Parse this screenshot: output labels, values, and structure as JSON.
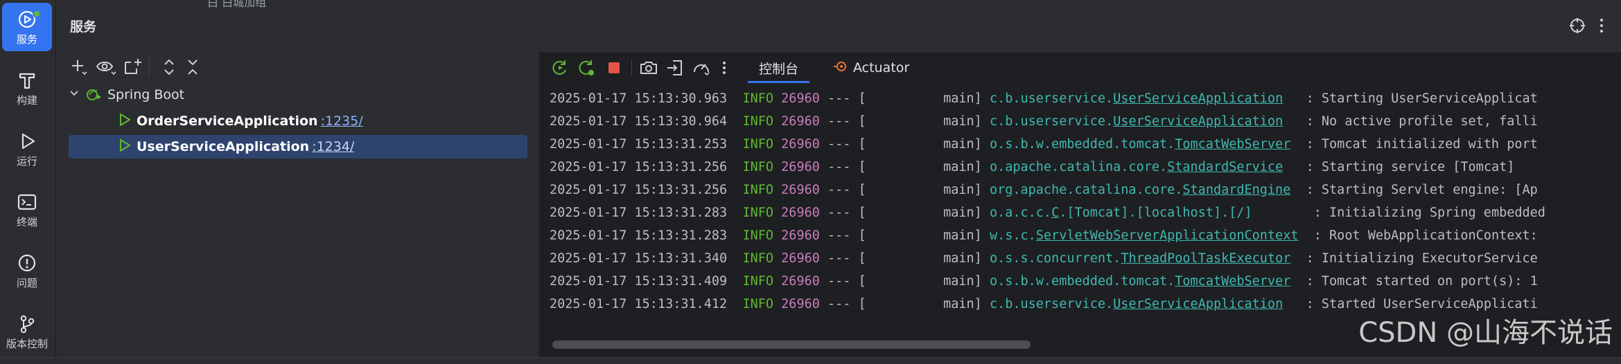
{
  "activity_bar": {
    "items": [
      {
        "label": "服务",
        "icon": "services-icon",
        "active": true
      },
      {
        "label": "构建",
        "icon": "build-hammer-icon",
        "active": false
      },
      {
        "label": "运行",
        "icon": "run-icon",
        "active": false
      },
      {
        "label": "终端",
        "icon": "terminal-icon",
        "active": false
      },
      {
        "label": "问题",
        "icon": "problems-icon",
        "active": false
      },
      {
        "label": "版本控制",
        "icon": "vcs-branch-icon",
        "active": false
      }
    ]
  },
  "header": {
    "title": "服务",
    "top_fragment": "白 白城加组"
  },
  "tree": {
    "root_label": "Spring Boot",
    "apps": [
      {
        "name": "OrderServiceApplication",
        "port": ":1235/",
        "selected": false
      },
      {
        "name": "UserServiceApplication",
        "port": ":1234/",
        "selected": true
      }
    ]
  },
  "console": {
    "tabs": [
      {
        "label": "控制台",
        "active": true
      },
      {
        "label": "Actuator",
        "active": false
      }
    ],
    "log": [
      {
        "ts": "2025-01-17 15:13:30.963",
        "level": "INFO",
        "pid": "26960",
        "sep": "--- [",
        "thread": "main]",
        "logger_pkg": "c.b.userservice.",
        "logger_cls": "UserServiceApplication",
        "msg": ": Starting UserServiceApplicat"
      },
      {
        "ts": "2025-01-17 15:13:30.964",
        "level": "INFO",
        "pid": "26960",
        "sep": "--- [",
        "thread": "main]",
        "logger_pkg": "c.b.userservice.",
        "logger_cls": "UserServiceApplication",
        "msg": ": No active profile set, falli"
      },
      {
        "ts": "2025-01-17 15:13:31.253",
        "level": "INFO",
        "pid": "26960",
        "sep": "--- [",
        "thread": "main]",
        "logger_pkg": "o.s.b.w.embedded.tomcat.",
        "logger_cls": "TomcatWebServer",
        "msg": ": Tomcat initialized with port"
      },
      {
        "ts": "2025-01-17 15:13:31.256",
        "level": "INFO",
        "pid": "26960",
        "sep": "--- [",
        "thread": "main]",
        "logger_pkg": "o.apache.catalina.core.",
        "logger_cls": "StandardService",
        "msg": ": Starting service [Tomcat]"
      },
      {
        "ts": "2025-01-17 15:13:31.256",
        "level": "INFO",
        "pid": "26960",
        "sep": "--- [",
        "thread": "main]",
        "logger_pkg": "org.apache.catalina.core.",
        "logger_cls": "StandardEngine",
        "msg": ": Starting Servlet engine: [Ap"
      },
      {
        "ts": "2025-01-17 15:13:31.283",
        "level": "INFO",
        "pid": "26960",
        "sep": "--- [",
        "thread": "main]",
        "logger_pkg": "o.a.c.c.",
        "logger_cls": "C",
        "logger_tail": ".[Tomcat].[localhost].[/]",
        "msg": ": Initializing Spring embedded"
      },
      {
        "ts": "2025-01-17 15:13:31.283",
        "level": "INFO",
        "pid": "26960",
        "sep": "--- [",
        "thread": "main]",
        "logger_pkg": "w.s.c.",
        "logger_cls": "ServletWebServerApplicationContext",
        "msg": ": Root WebApplicationContext: "
      },
      {
        "ts": "2025-01-17 15:13:31.340",
        "level": "INFO",
        "pid": "26960",
        "sep": "--- [",
        "thread": "main]",
        "logger_pkg": "o.s.s.concurrent.",
        "logger_cls": "ThreadPoolTaskExecutor",
        "msg": ": Initializing ExecutorService"
      },
      {
        "ts": "2025-01-17 15:13:31.409",
        "level": "INFO",
        "pid": "26960",
        "sep": "--- [",
        "thread": "main]",
        "logger_pkg": "o.s.b.w.embedded.tomcat.",
        "logger_cls": "TomcatWebServer",
        "msg": ": Tomcat started on port(s): 1"
      },
      {
        "ts": "2025-01-17 15:13:31.412",
        "level": "INFO",
        "pid": "26960",
        "sep": "--- [",
        "thread": "main]",
        "logger_pkg": "c.b.userservice.",
        "logger_cls": "UserServiceApplication",
        "msg": ": Started UserServiceApplicati"
      }
    ]
  },
  "watermark": "CSDN @山海不说话",
  "colors": {
    "accent": "#3574f0",
    "info": "#5fb832",
    "pid": "#c77dbb",
    "logger": "#3fb9b0",
    "stop": "#e5534b"
  }
}
